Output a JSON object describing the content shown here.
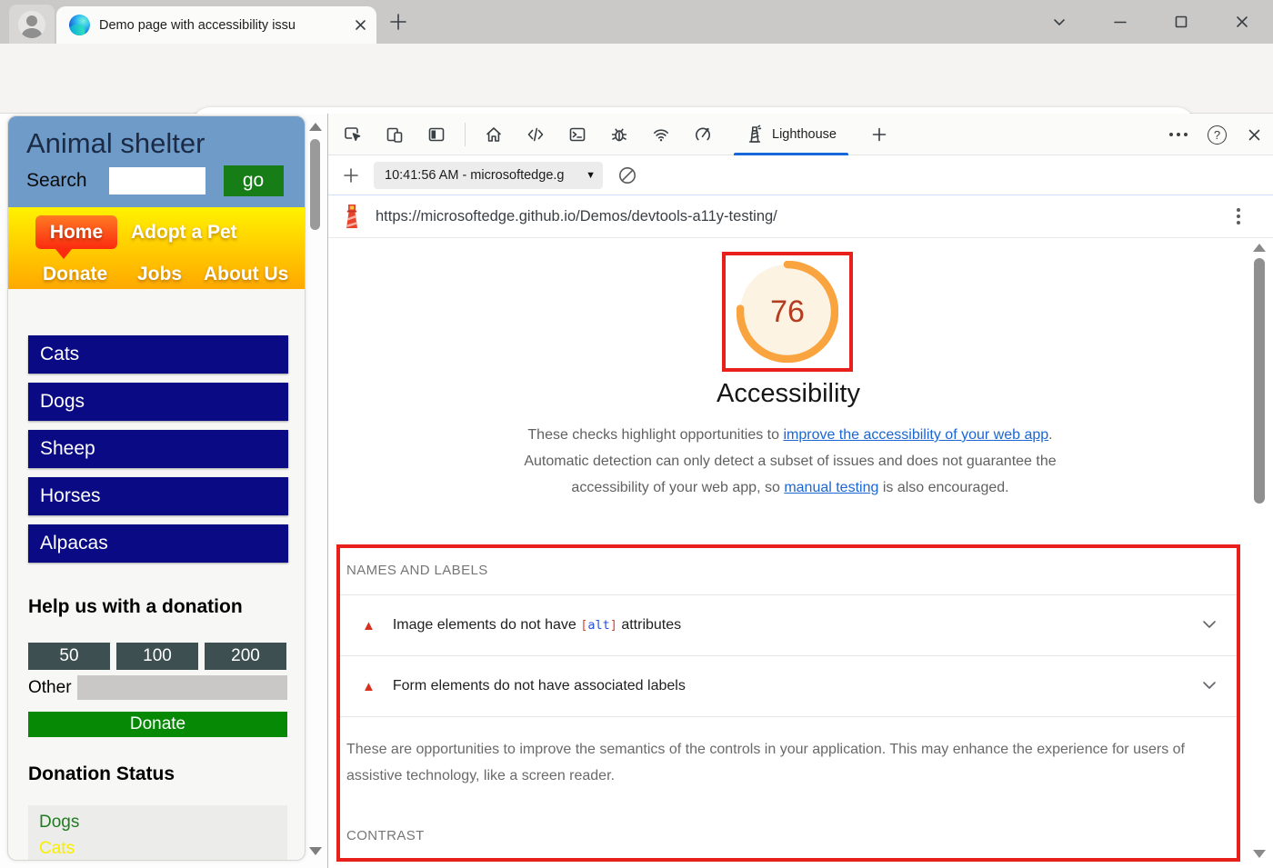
{
  "browser": {
    "tab_title": "Demo page with accessibility issu",
    "url": {
      "host": "microsoftedge.github.io",
      "path": "/Demos/devtools-a11y-testing/"
    }
  },
  "shelter_page": {
    "title": "Animal shelter",
    "search_label": "Search",
    "search_value": "",
    "go_button": "go",
    "nav": {
      "home": "Home",
      "adopt": "Adopt a Pet",
      "donate": "Donate",
      "jobs": "Jobs",
      "about": "About Us"
    },
    "animal_links": [
      "Cats",
      "Dogs",
      "Sheep",
      "Horses",
      "Alpacas"
    ],
    "donation": {
      "heading": "Help us with a donation",
      "amounts": [
        "50",
        "100",
        "200"
      ],
      "other_label": "Other",
      "other_value": "",
      "donate_button": "Donate"
    },
    "status": {
      "heading": "Donation Status",
      "items": [
        "Dogs",
        "Cats"
      ]
    }
  },
  "devtools": {
    "active_tab": "Lighthouse",
    "run_history": "10:41:56 AM - microsoftedge.g",
    "audited_url": "https://microsoftedge.github.io/Demos/devtools-a11y-testing/"
  },
  "lighthouse_report": {
    "score": "76",
    "category": "Accessibility",
    "intro": {
      "t1": "These checks highlight opportunities to ",
      "link1": "improve the accessibility of your web app",
      "t2": ". Automatic detection can only detect a subset of issues and does not guarantee the accessibility of your web app, so ",
      "link2": "manual testing",
      "t3": " is also encouraged."
    },
    "sections": {
      "names_and_labels": "NAMES AND LABELS",
      "contrast": "CONTRAST"
    },
    "audits": [
      {
        "pre": "Image elements do not have ",
        "code_open": "[",
        "code": "alt",
        "code_close": "]",
        "post": " attributes"
      },
      {
        "pre": "Form elements do not have associated labels",
        "code_open": "",
        "code": "",
        "code_close": "",
        "post": ""
      }
    ],
    "note": "These are opportunities to improve the semantics of the controls in your application. This may enhance the experience for users of assistive technology, like a screen reader."
  },
  "icons": {
    "warning": "▲",
    "caret_down": "▼"
  },
  "colors": {
    "highlight_box": "#e7201c",
    "score_arc": "#f9a43e",
    "score_fill": "#fdf3e3",
    "score_text": "#b43d20",
    "devtools_accent": "#1667d9",
    "link_blue": "#1b66d2",
    "warning_red": "#d7301f",
    "page_header_blue": "#6f9bc9",
    "nav_gradient_top": "#fff200",
    "nav_gradient_bottom": "#ffa800",
    "animal_navy": "#0a0a85",
    "donate_green": "#068a06",
    "status_dogs_green": "#217c21",
    "status_cats_yellow": "#f8ef00"
  }
}
